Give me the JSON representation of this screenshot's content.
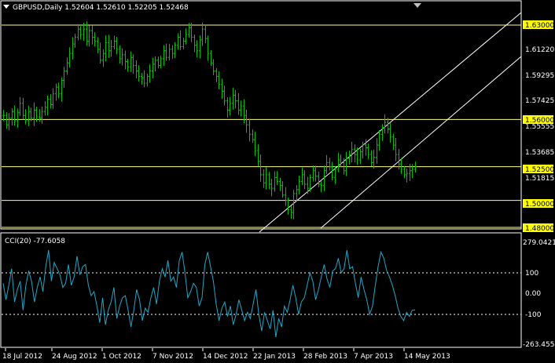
{
  "window": {
    "symbol_header": "GBPUSD,Daily  1.52604 1.52610 1.52205 1.52468",
    "menu_icon": "triangle-down-icon",
    "scroll_marker_icon": "triangle-down-icon"
  },
  "colors": {
    "background": "#000000",
    "frame": "#ffffff",
    "candle": "#00c000",
    "levels": "#ffff80",
    "level_tag_bg": "#ffff00",
    "channel": "#ffffff",
    "cci_line": "#20a8c8",
    "cci_levels": "#ffffff"
  },
  "price_axis": {
    "ticks": [
      "1.61220",
      "1.59295",
      "1.57425",
      "1.55555",
      "1.53685",
      "1.51815"
    ]
  },
  "level_tags": [
    "1.63000",
    "1.56000",
    "1.52500",
    "1.50000",
    "1.48000"
  ],
  "indicator": {
    "name": "CCI(20) -77.6058",
    "axis": [
      "279.0421",
      "100",
      "0.00",
      "-100",
      "-263.4551"
    ]
  },
  "time_axis": [
    "18 Jul 2012",
    "24 Aug 2012",
    "1 Oct 2012",
    "7 Nov 2012",
    "14 Dec 2012",
    "22 Jan 2013",
    "28 Feb 2013",
    "7 Apr 2013",
    "14 May 2013"
  ],
  "chart_data": {
    "type": "candlestick",
    "title": "GBPUSD,Daily  1.52604 1.52610 1.52205 1.52468",
    "ylim": [
      1.48,
      1.635
    ],
    "horizontal_levels": [
      1.63,
      1.56,
      1.525,
      1.5,
      1.48
    ],
    "series": [
      {
        "name": "GBPUSD,Daily",
        "close": [
          1.563,
          1.556,
          1.561,
          1.566,
          1.559,
          1.565,
          1.572,
          1.563,
          1.559,
          1.566,
          1.561,
          1.567,
          1.562,
          1.561,
          1.566,
          1.569,
          1.575,
          1.571,
          1.579,
          1.584,
          1.579,
          1.589,
          1.596,
          1.602,
          1.609,
          1.616,
          1.621,
          1.627,
          1.623,
          1.627,
          1.618,
          1.626,
          1.621,
          1.618,
          1.612,
          1.604,
          1.609,
          1.617,
          1.611,
          1.614,
          1.618,
          1.612,
          1.605,
          1.608,
          1.603,
          1.599,
          1.606,
          1.6,
          1.596,
          1.592,
          1.591,
          1.587,
          1.592,
          1.596,
          1.601,
          1.604,
          1.6,
          1.605,
          1.611,
          1.606,
          1.612,
          1.609,
          1.615,
          1.621,
          1.614,
          1.618,
          1.623,
          1.628,
          1.621,
          1.615,
          1.611,
          1.619,
          1.627,
          1.62,
          1.609,
          1.602,
          1.596,
          1.592,
          1.586,
          1.581,
          1.574,
          1.567,
          1.572,
          1.578,
          1.574,
          1.567,
          1.57,
          1.563,
          1.556,
          1.549,
          1.545,
          1.537,
          1.529,
          1.519,
          1.513,
          1.519,
          1.512,
          1.509,
          1.517,
          1.514,
          1.511,
          1.504,
          1.5,
          1.493,
          1.491,
          1.505,
          1.508,
          1.514,
          1.519,
          1.512,
          1.509,
          1.517,
          1.522,
          1.518,
          1.512,
          1.511,
          1.522,
          1.528,
          1.525,
          1.517,
          1.523,
          1.53,
          1.528,
          1.522,
          1.531,
          1.534,
          1.538,
          1.534,
          1.53,
          1.536,
          1.541,
          1.539,
          1.534,
          1.528,
          1.532,
          1.541,
          1.549,
          1.554,
          1.558,
          1.553,
          1.547,
          1.541,
          1.534,
          1.527,
          1.523,
          1.519,
          1.52,
          1.522,
          1.523,
          1.525
        ]
      }
    ],
    "channel_lines": [
      {
        "from_date": "22 Jan 2013",
        "from_price": 1.48,
        "to_price": 1.645,
        "extends": "right"
      },
      {
        "from_date": "28 Feb 2013",
        "from_price": 1.483,
        "to_price": 1.605,
        "extends": "right"
      }
    ],
    "subchart": {
      "type": "line",
      "name": "CCI(20) -77.6058",
      "ylim": [
        -263.4551,
        279.0421
      ],
      "levels": [
        100,
        -100
      ],
      "values": [
        50,
        -30,
        40,
        120,
        -40,
        20,
        60,
        -80,
        40,
        110,
        60,
        -40,
        30,
        80,
        10,
        130,
        210,
        60,
        150,
        120,
        90,
        30,
        50,
        140,
        40,
        80,
        180,
        90,
        130,
        140,
        40,
        -10,
        10,
        -60,
        -140,
        -20,
        -150,
        -80,
        -40,
        30,
        -120,
        -60,
        -20,
        -10,
        -80,
        -160,
        -80,
        20,
        -30,
        -130,
        -70,
        -90,
        -20,
        30,
        -50,
        60,
        120,
        80,
        160,
        60,
        80,
        30,
        160,
        200,
        100,
        -20,
        10,
        50,
        30,
        -60,
        -20,
        140,
        200,
        130,
        60,
        -50,
        -130,
        -70,
        -40,
        -110,
        -60,
        -150,
        -100,
        -30,
        -80,
        -130,
        -90,
        -120,
        -50,
        20,
        -100,
        -180,
        -90,
        -130,
        -170,
        -80,
        -210,
        -120,
        -160,
        -60,
        -90,
        -30,
        40,
        -20,
        -100,
        -40,
        -20,
        40,
        100,
        60,
        -30,
        20,
        80,
        140,
        70,
        30,
        110,
        120,
        170,
        100,
        120,
        210,
        120,
        130,
        50,
        -20,
        80,
        20,
        -30,
        -100,
        -60,
        40,
        130,
        200,
        170,
        110,
        80,
        40,
        -10,
        -70,
        -110,
        -130,
        -90,
        -110,
        -80,
        -78
      ]
    }
  }
}
